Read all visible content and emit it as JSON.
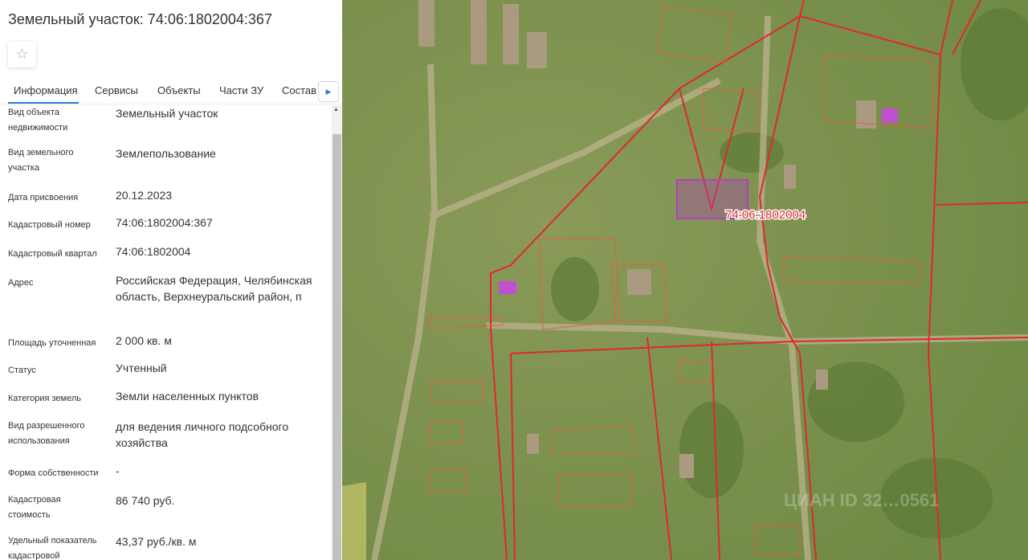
{
  "header": {
    "title": "Земельный участок: 74:06:1802004:367",
    "favorite_icon": "star-icon"
  },
  "tabs": [
    {
      "label": "Информация"
    },
    {
      "label": "Сервисы"
    },
    {
      "label": "Объекты"
    },
    {
      "label": "Части ЗУ"
    },
    {
      "label": "Состав"
    }
  ],
  "rows": [
    {
      "label": "Вид объекта недвижимости",
      "value": "Земельный участок"
    },
    {
      "label": "Вид земельного участка",
      "value": "Землепользование"
    },
    {
      "label": "Дата присвоения",
      "value": "20.12.2023"
    },
    {
      "label": "Кадастровый номер",
      "value": "74:06:1802004:367"
    },
    {
      "label": "Кадастровый квартал",
      "value": "74:06:1802004"
    },
    {
      "label": "Адрес",
      "value": "Российская Федерация, Челябинская область, Верхнеуральский район, п"
    },
    {
      "label": "Площадь уточненная",
      "value": "2 000 кв. м"
    },
    {
      "label": "Статус",
      "value": "Учтенный"
    },
    {
      "label": "Категория земель",
      "value": "Земли населенных пунктов"
    },
    {
      "label": "Вид разрешенного использования",
      "value": "для ведения личного подсобного хозяйства"
    },
    {
      "label": "Форма собственности",
      "value": "-"
    },
    {
      "label": "Кадастровая стоимость",
      "value": "86 740 руб."
    },
    {
      "label": "Удельный показатель кадастровой",
      "value": "43,37 руб./кв. м"
    }
  ],
  "map": {
    "quarter_label": "74:06:1802004",
    "watermark": "ЦИАН ID 32…0561",
    "boundary_color": "#e0282e",
    "parcel_color": "#b040c0"
  }
}
